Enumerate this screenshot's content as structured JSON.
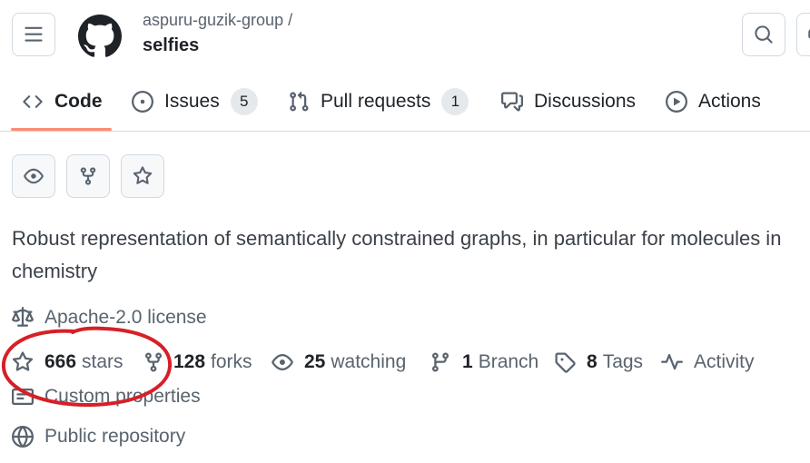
{
  "header": {
    "owner": "aspuru-guzik-group /",
    "repo": "selfies"
  },
  "tabs": [
    {
      "label": "Code",
      "icon": "code-icon"
    },
    {
      "label": "Issues",
      "count": "5",
      "icon": "issue-icon"
    },
    {
      "label": "Pull requests",
      "count": "1",
      "icon": "pull-request-icon"
    },
    {
      "label": "Discussions",
      "icon": "discussions-icon"
    },
    {
      "label": "Actions",
      "icon": "play-icon"
    }
  ],
  "description": "Robust representation of semantically constrained graphs, in particular for molecules in chemistry",
  "license": "Apache-2.0 license",
  "stats": {
    "stars_count": "666",
    "stars_label": "stars",
    "forks_count": "128",
    "forks_label": "forks",
    "watching_count": "25",
    "watching_label": "watching",
    "branch_count": "1",
    "branch_label": "Branch",
    "tags_count": "8",
    "tags_label": "Tags",
    "activity_label": "Activity"
  },
  "custom_properties": "Custom properties",
  "visibility": "Public repository",
  "colors": {
    "active_tab_underline": "#fd8c73",
    "annotation_circle": "#d62027",
    "counter_bg": "#e6e9ec"
  }
}
